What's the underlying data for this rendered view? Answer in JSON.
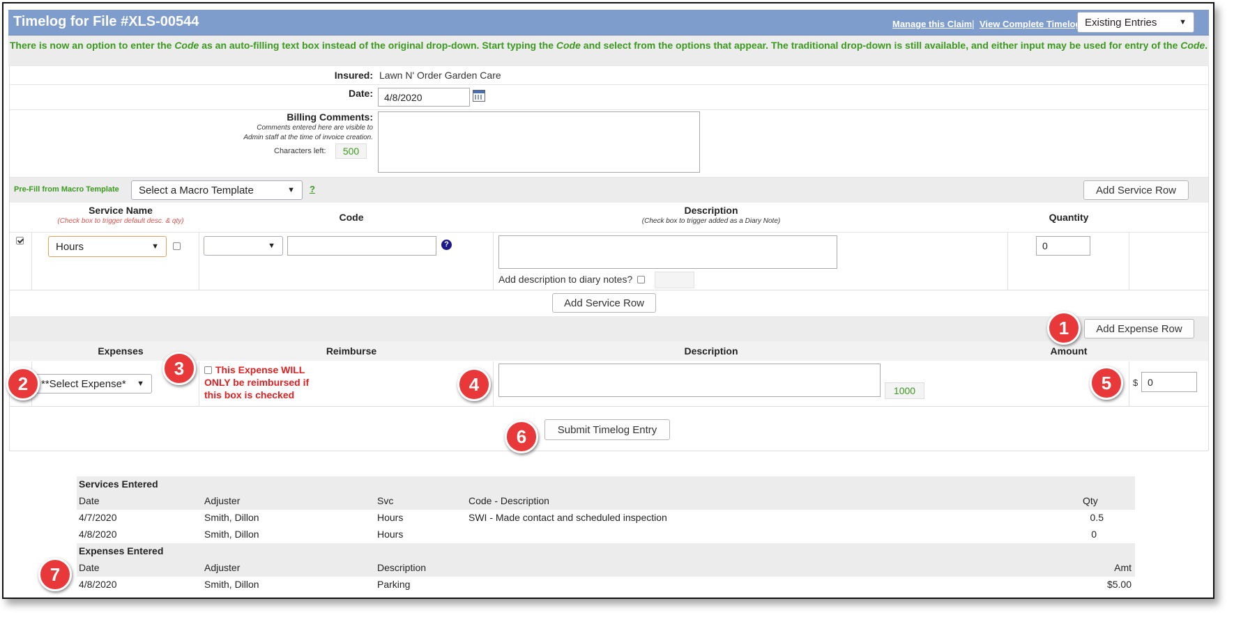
{
  "header": {
    "title": "Timelog for File #XLS-00544",
    "manage_link": "Manage this Claim",
    "separator": "|",
    "view_link": "View Complete Timelog",
    "existing_select": "Existing Entries"
  },
  "notice": {
    "part1": "There is now an option to enter the ",
    "code1": "Code",
    "part2": " as an auto-filling text box instead of the original drop-down. Start typing the ",
    "code2": "Code",
    "part3": " and select from the options that appear. The traditional drop-down is still available, and either input may be used for entry of the ",
    "code3": "Code",
    "part4": "."
  },
  "form": {
    "insured_label": "Insured:",
    "insured_value": "Lawn N' Order Garden Care",
    "date_label": "Date:",
    "date_value": "4/8/2020",
    "billing_label": "Billing Comments:",
    "billing_help_1": "Comments entered here are visible to",
    "billing_help_2": "Admin staff at the time of invoice creation.",
    "chars_left_label": "Characters left:",
    "chars_left_value": "500"
  },
  "macro": {
    "label": "Pre-Fill from Macro Template",
    "select": "Select a Macro Template",
    "help": "?",
    "add_service_row_top": "Add Service Row"
  },
  "services": {
    "col_service": "Service Name",
    "col_service_sub": "(Check box to trigger default desc. & qty)",
    "col_code": "Code",
    "col_description": "Description",
    "col_description_sub": "(Check box to trigger added as a Diary Note)",
    "col_quantity": "Quantity",
    "service_value": "Hours",
    "code_help": "?",
    "diary_label": "Add description to diary notes?",
    "quantity_value": "0",
    "add_service_row": "Add Service Row"
  },
  "expenses": {
    "add_expense_row": "Add Expense Row",
    "col_expenses": "Expenses",
    "col_reimburse": "Reimburse",
    "col_description": "Description",
    "col_amount": "Amount",
    "expense_select": "**Select Expense*",
    "reimburse_note_1": "This Expense WILL",
    "reimburse_note_2": "ONLY be reimbursed if",
    "reimburse_note_3": "this box is checked",
    "desc_counter": "1000",
    "currency": "$",
    "amount_value": "0",
    "submit": "Submit Timelog Entry"
  },
  "badges": [
    "1",
    "2",
    "3",
    "4",
    "5",
    "6",
    "7"
  ],
  "services_entered": {
    "title": "Services Entered",
    "headers": [
      "Date",
      "Adjuster",
      "Svc",
      "Code - Description",
      "Qty"
    ],
    "rows": [
      [
        "4/7/2020",
        "Smith, Dillon",
        "Hours",
        "SWI - Made contact and scheduled inspection",
        "0.5"
      ],
      [
        "4/8/2020",
        "Smith, Dillon",
        "Hours",
        "",
        "0"
      ]
    ]
  },
  "expenses_entered": {
    "title": "Expenses Entered",
    "headers": [
      "Date",
      "Adjuster",
      "Description",
      "Amt"
    ],
    "rows": [
      [
        "4/8/2020",
        "Smith, Dillon",
        "Parking",
        "$5.00"
      ]
    ]
  },
  "colors": {
    "title_bar": "#7f9dcc",
    "notice_text": "#3b9a1e",
    "badge": "#e8383a",
    "warning_text": "#e02020"
  }
}
